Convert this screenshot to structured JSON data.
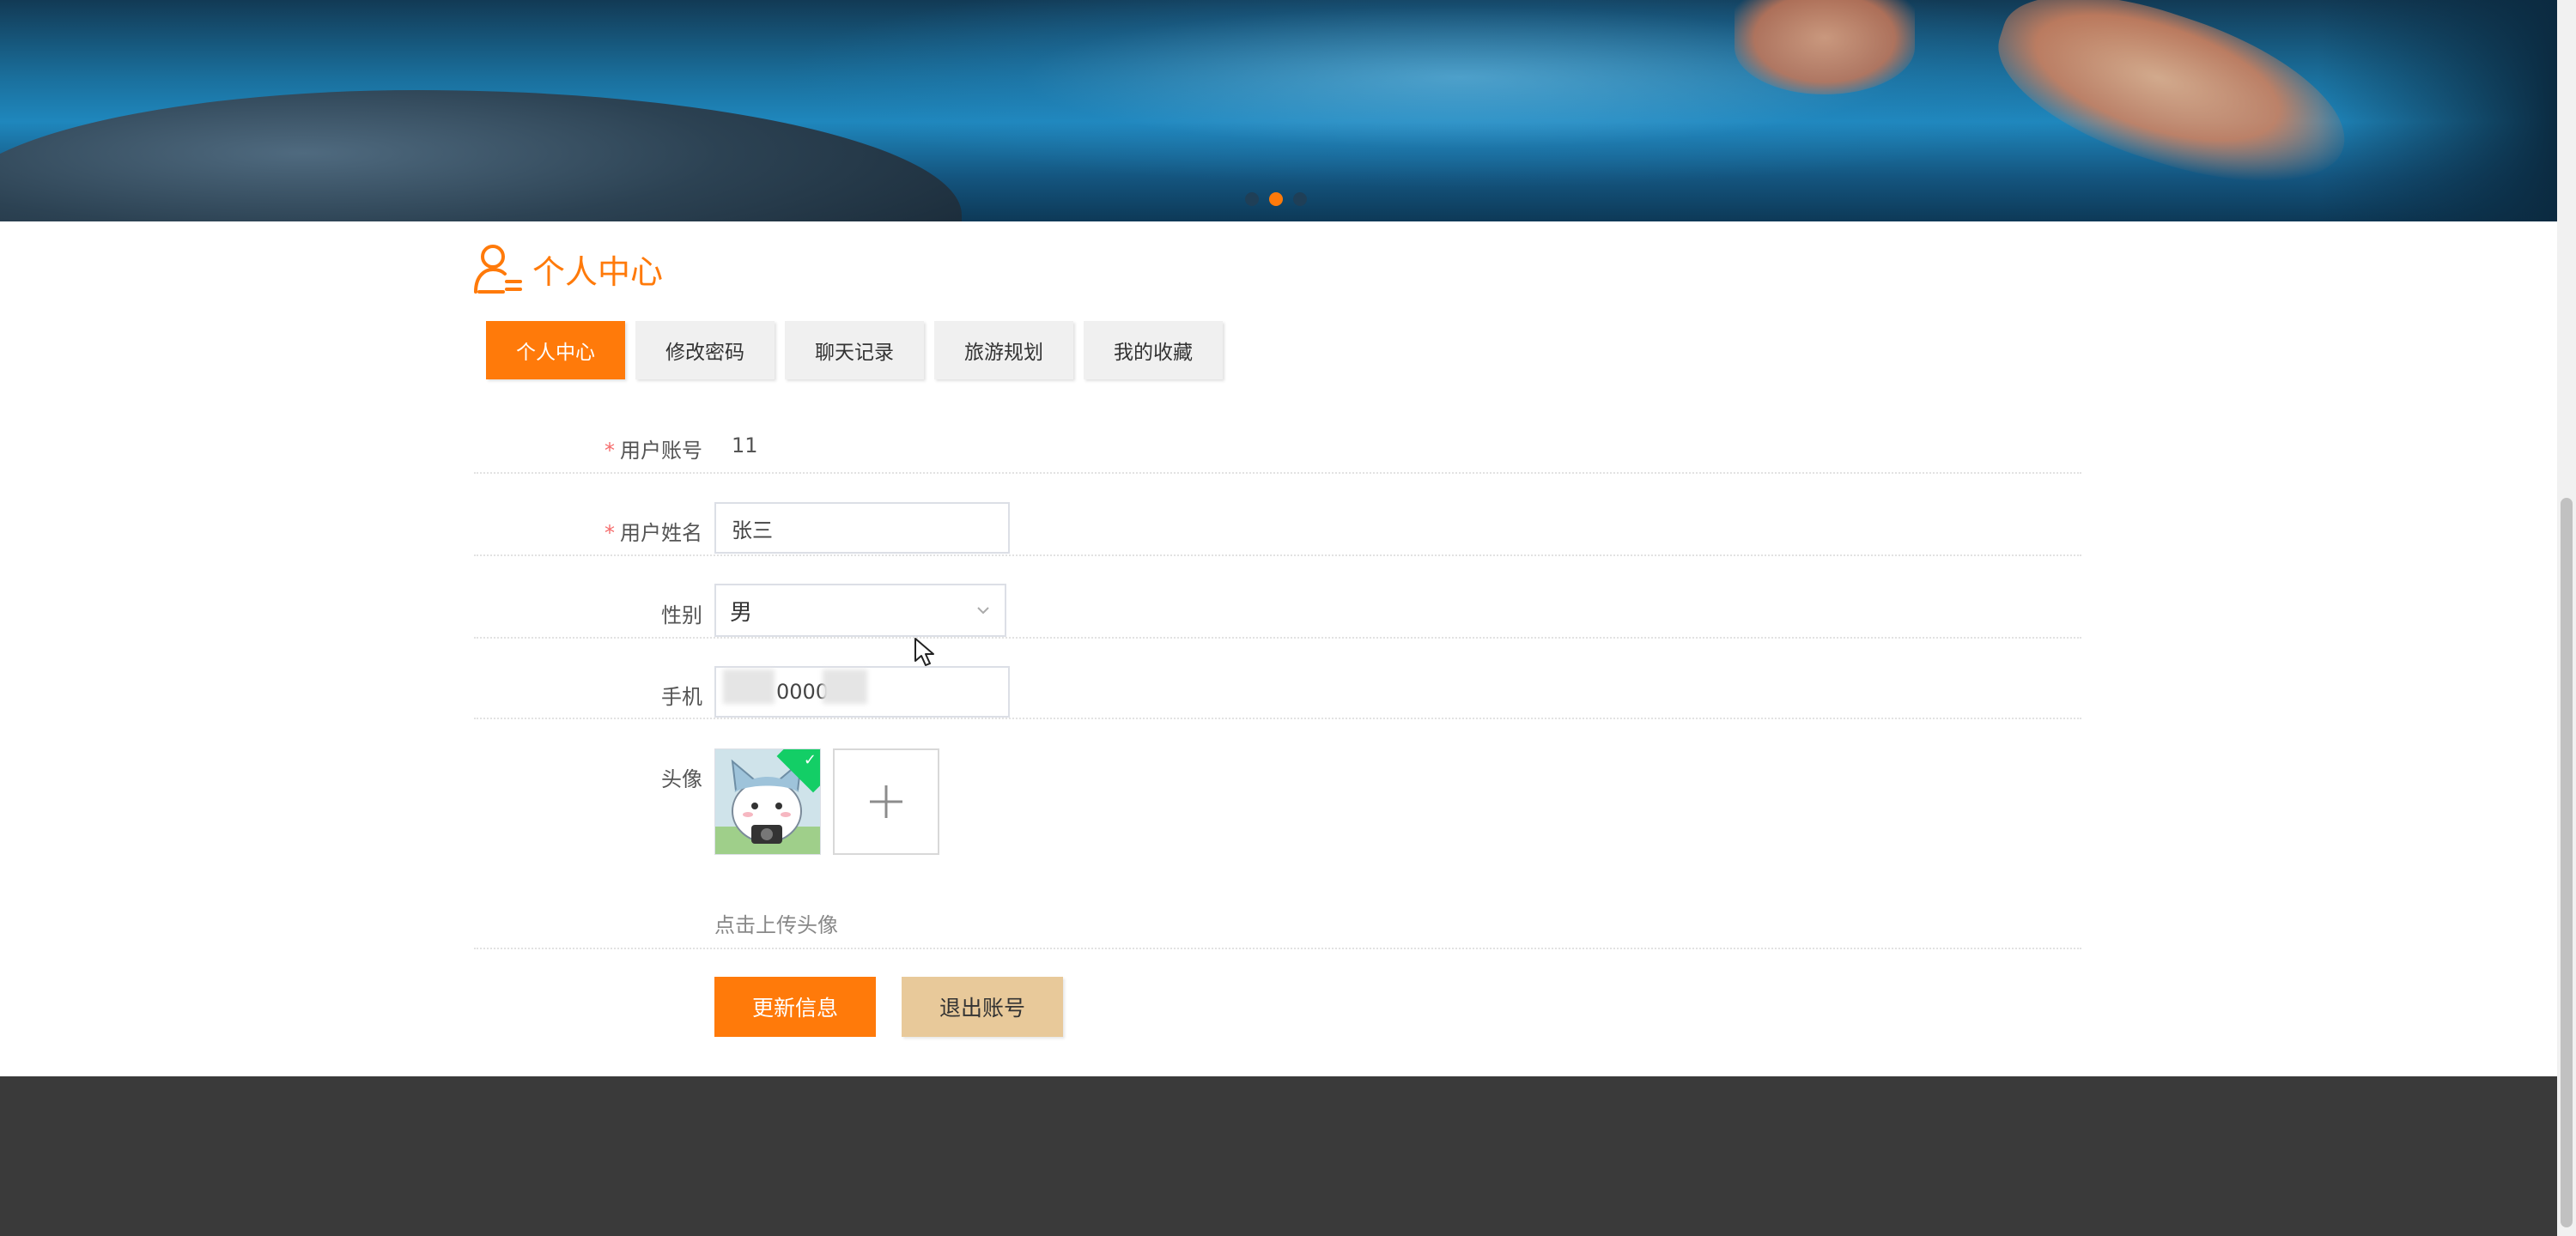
{
  "banner": {
    "carousel_active_index": 1,
    "carousel_count": 3
  },
  "page": {
    "title": "个人中心"
  },
  "tabs": [
    {
      "label": "个人中心",
      "active": true
    },
    {
      "label": "修改密码",
      "active": false
    },
    {
      "label": "聊天记录",
      "active": false
    },
    {
      "label": "旅游规划",
      "active": false
    },
    {
      "label": "我的收藏",
      "active": false
    }
  ],
  "form": {
    "account": {
      "label": "用户账号",
      "required": true,
      "value": "11"
    },
    "name": {
      "label": "用户姓名",
      "required": true,
      "value": "张三"
    },
    "gender": {
      "label": "性别",
      "value": "男"
    },
    "phone": {
      "label": "手机",
      "value": "0000"
    },
    "avatar": {
      "label": "头像",
      "upload_tip": "点击上传头像"
    },
    "required_mark": "*"
  },
  "buttons": {
    "update": "更新信息",
    "logout": "退出账号"
  },
  "colors": {
    "accent": "#ff7a0a",
    "secondary_button": "#e8c99a",
    "footer": "#3a3a3a"
  }
}
